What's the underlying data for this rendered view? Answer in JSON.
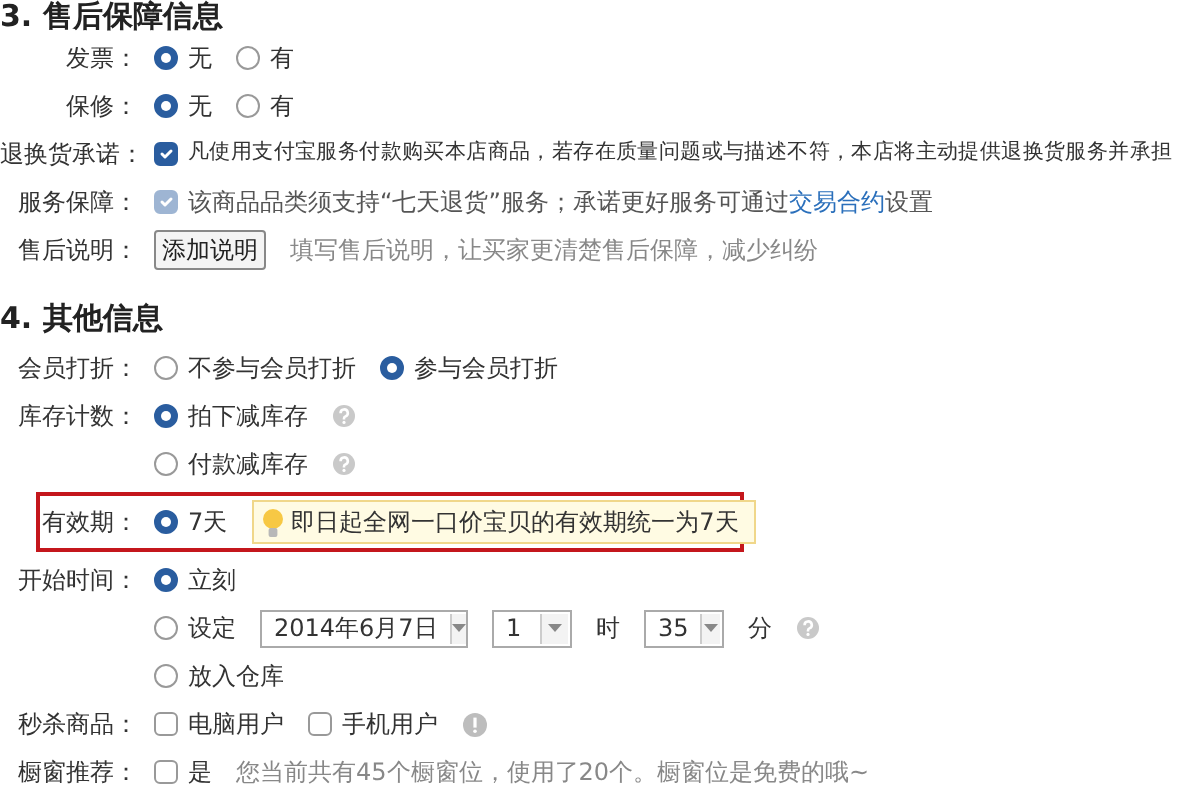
{
  "sections": [
    {
      "title": "3. 售后保障信息",
      "rows": [
        {
          "label": "发票：",
          "lines": [
            [
              {
                "kind": "radio",
                "text": "无",
                "checked": true
              },
              {
                "kind": "radio",
                "text": "有",
                "checked": false
              }
            ]
          ]
        },
        {
          "label": "保修：",
          "lines": [
            [
              {
                "kind": "radio",
                "text": "无",
                "checked": true
              },
              {
                "kind": "radio",
                "text": "有",
                "checked": false
              }
            ]
          ]
        },
        {
          "label": "退换货承诺：",
          "lines": [
            [
              {
                "kind": "checkbox",
                "checked": true,
                "disabled": false,
                "text": "凡使用支付宝服务付款购买本店商品，若存在质量问题或与描述不符，本店将主动提供退换货服务并承担"
              }
            ]
          ]
        },
        {
          "label": "服务保障：",
          "lines": [
            [
              {
                "kind": "checkbox",
                "checked": true,
                "disabled": true,
                "text": "该商品品类须支持“七天退货”服务；承诺更好服务可通过",
                "link": "交易合约",
                "text_after": "设置"
              }
            ]
          ]
        },
        {
          "label": "售后说明：",
          "lines": [
            [
              {
                "kind": "button",
                "text": "添加说明"
              },
              {
                "kind": "hint",
                "text": "填写售后说明，让买家更清楚售后保障，减少纠纷"
              }
            ]
          ]
        }
      ]
    },
    {
      "title": "4. 其他信息",
      "rows": [
        {
          "label": "会员打折：",
          "lines": [
            [
              {
                "kind": "radio",
                "text": "不参与会员打折",
                "checked": false
              },
              {
                "kind": "radio",
                "text": "参与会员打折",
                "checked": true
              }
            ]
          ]
        },
        {
          "label": "库存计数：",
          "lines": [
            [
              {
                "kind": "radio",
                "text": "拍下减库存",
                "checked": true
              },
              {
                "kind": "help"
              }
            ],
            [
              {
                "kind": "radio",
                "text": "付款减库存",
                "checked": false
              },
              {
                "kind": "help"
              }
            ]
          ]
        },
        {
          "label": "有效期：",
          "highlighted": true,
          "lines": [
            [
              {
                "kind": "radio",
                "text": "7天",
                "checked": true
              },
              {
                "kind": "tip",
                "text": "即日起全网一口价宝贝的有效期统一为7天"
              }
            ]
          ]
        },
        {
          "label": "开始时间：",
          "lines": [
            [
              {
                "kind": "radio",
                "text": "立刻",
                "checked": true
              }
            ],
            [
              {
                "kind": "radio",
                "text": "设定",
                "checked": false
              },
              {
                "kind": "select",
                "value": "2014年6月7日"
              },
              {
                "kind": "select",
                "value": "1"
              },
              {
                "kind": "text",
                "text": "时"
              },
              {
                "kind": "select",
                "value": "35"
              },
              {
                "kind": "text",
                "text": "分"
              },
              {
                "kind": "help"
              }
            ],
            [
              {
                "kind": "radio",
                "text": "放入仓库",
                "checked": false
              }
            ]
          ]
        },
        {
          "label": "秒杀商品：",
          "lines": [
            [
              {
                "kind": "checkbox",
                "checked": false,
                "disabled": false,
                "text": "电脑用户"
              },
              {
                "kind": "checkbox",
                "checked": false,
                "disabled": false,
                "text": "手机用户"
              },
              {
                "kind": "info"
              }
            ]
          ]
        },
        {
          "label": "橱窗推荐：",
          "lines": [
            [
              {
                "kind": "checkbox",
                "checked": false,
                "disabled": false,
                "text": "是"
              },
              {
                "kind": "hint",
                "text": "您当前共有45个橱窗位，使用了20个。橱窗位是免费的哦~"
              }
            ]
          ]
        }
      ]
    }
  ]
}
